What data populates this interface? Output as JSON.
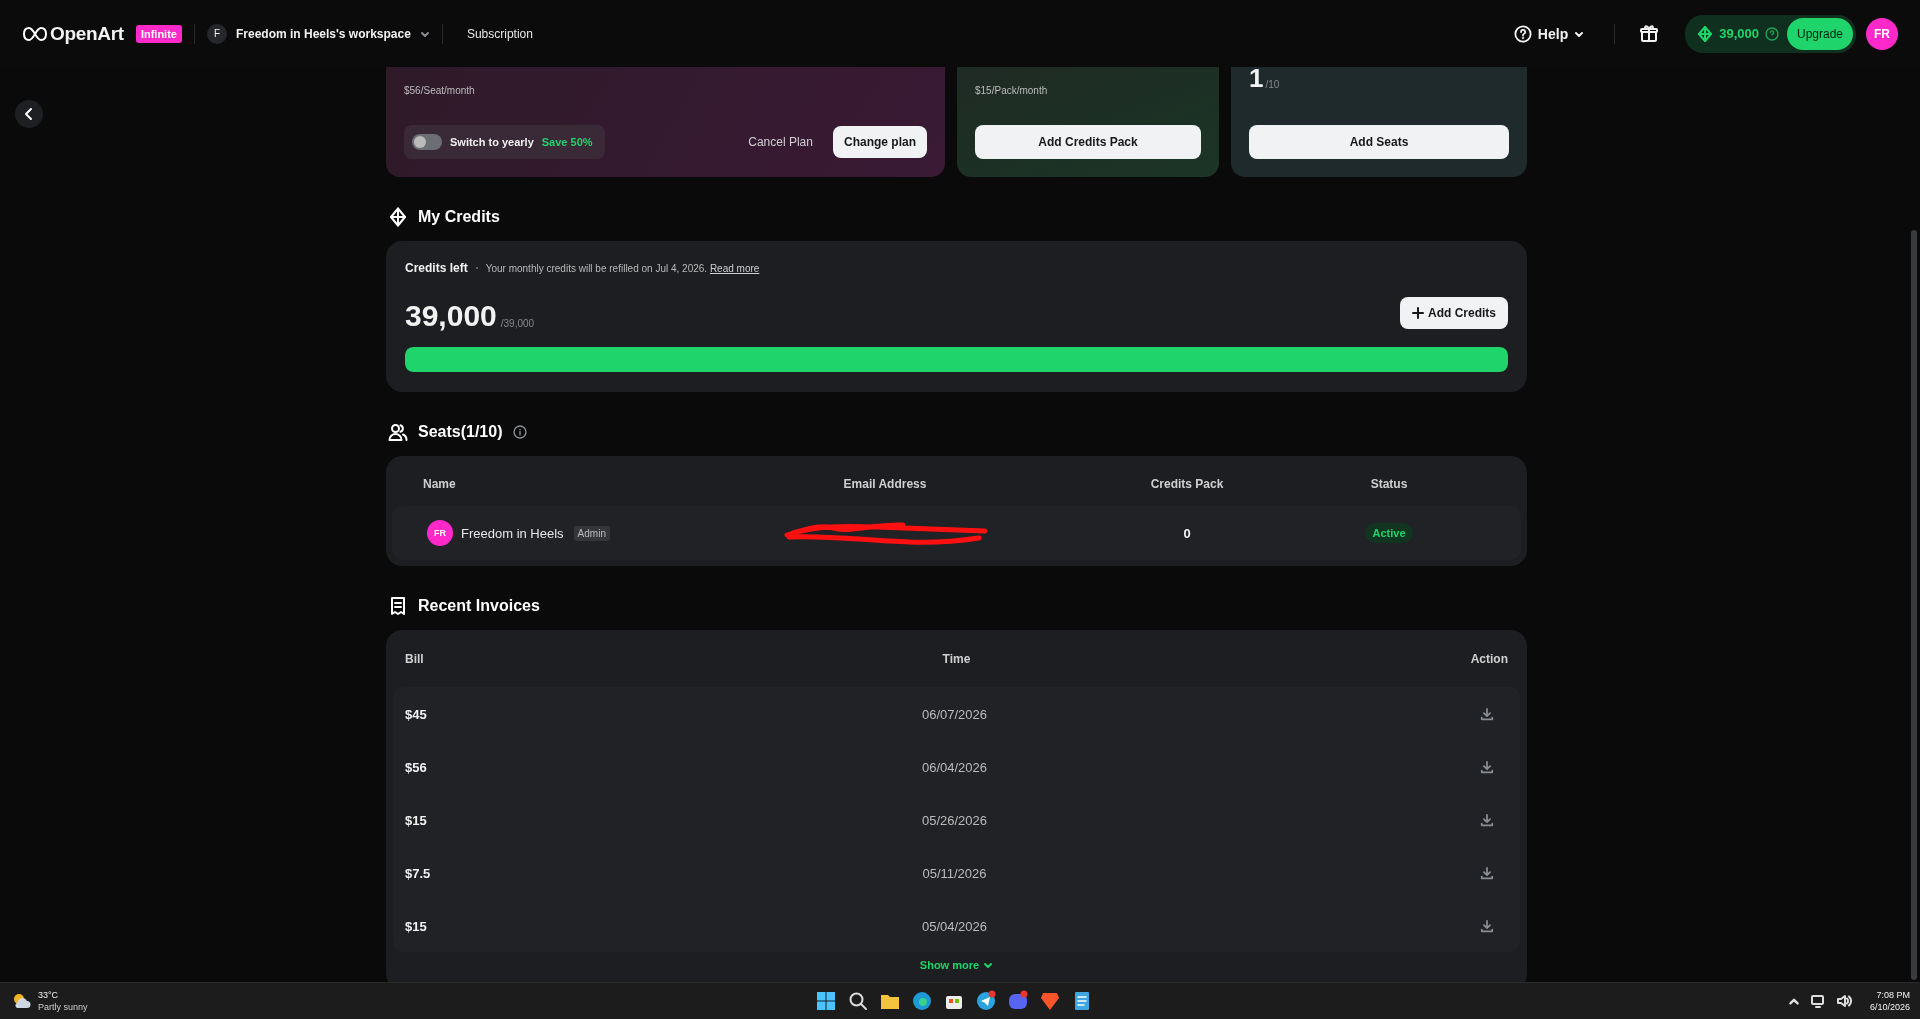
{
  "header": {
    "logo": "OpenArt",
    "plan_badge": "Infinite",
    "workspace": {
      "initial": "F",
      "name": "Freedom in Heels's workspace"
    },
    "nav": "Subscription",
    "help": "Help",
    "credits": "39,000",
    "upgrade": "Upgrade",
    "avatar": "FR"
  },
  "plan_card": {
    "price": "$56/Seat/month",
    "toggle": {
      "label": "Switch to yearly",
      "on": false
    },
    "save": "Save 50%",
    "cancel": "Cancel Plan",
    "change": "Change plan"
  },
  "pack_card": {
    "price": "$15/Pack/month",
    "button": "Add Credits Pack"
  },
  "seats_card": {
    "count": "1",
    "total": "/10",
    "button": "Add Seats"
  },
  "credits": {
    "heading": "My Credits",
    "label": "Credits left",
    "note": "Your monthly credits will be refilled on Jul 4, 2026.",
    "link": "Read more",
    "amount": "39,000",
    "total": "/39,000",
    "button": "Add Credits",
    "level": 1
  },
  "seats": {
    "heading": "Seats(1/10)",
    "columns": [
      "Name",
      "Email Address",
      "Credits Pack",
      "Status"
    ],
    "rows": [
      {
        "avatar": "FR",
        "name": "Freedom in Heels",
        "role": "Admin",
        "email": {
          "redacted": true
        },
        "credits_pack": "0",
        "status": "Active"
      }
    ]
  },
  "invoices": {
    "heading": "Recent Invoices",
    "columns": [
      "Bill",
      "Time",
      "Action"
    ],
    "rows": [
      {
        "bill": "$45",
        "time": "06/07/2026"
      },
      {
        "bill": "$56",
        "time": "06/04/2026"
      },
      {
        "bill": "$15",
        "time": "05/26/2026"
      },
      {
        "bill": "$7.5",
        "time": "05/11/2026"
      },
      {
        "bill": "$15",
        "time": "05/04/2026"
      }
    ],
    "show_more": "Show more"
  },
  "taskbar": {
    "temperature": "33°C",
    "weather": "Partly sunny",
    "time": "7:08 PM",
    "date": "6/10/2026"
  }
}
